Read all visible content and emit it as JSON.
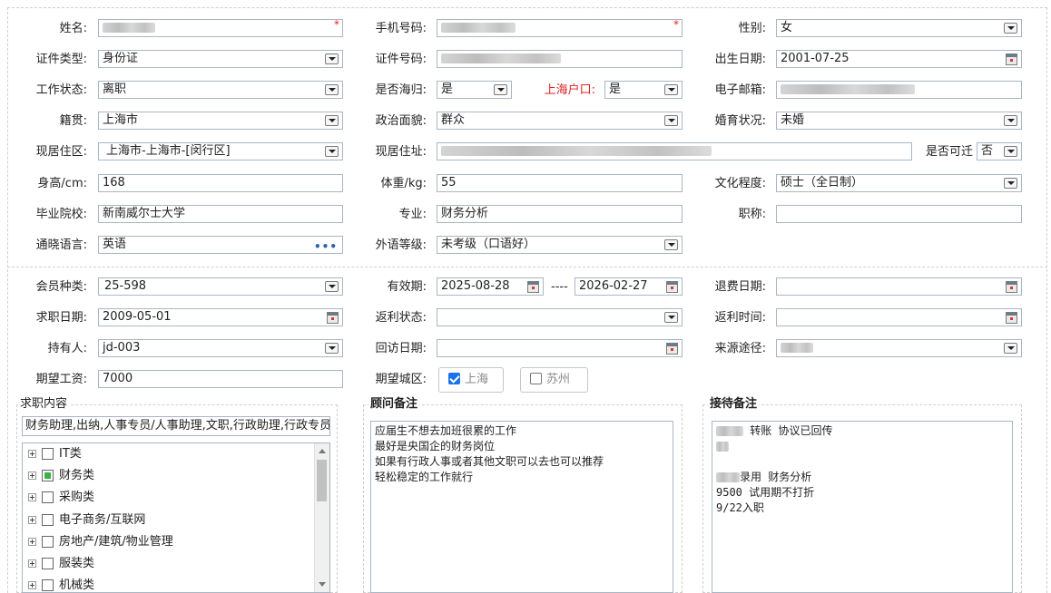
{
  "profile": {
    "name": {
      "label": "姓名:",
      "required_mark": "*"
    },
    "mobile": {
      "label": "手机号码:",
      "required_mark": "*"
    },
    "gender": {
      "label": "性别:",
      "value": "女"
    },
    "id_type": {
      "label": "证件类型:",
      "value": "身份证"
    },
    "id_number": {
      "label": "证件号码:"
    },
    "birth_date": {
      "label": "出生日期:",
      "value": "2001-07-25"
    },
    "work_status": {
      "label": "工作状态:",
      "value": "离职"
    },
    "returnee": {
      "label": "是否海归:",
      "value": "是"
    },
    "shanghai_hukou": {
      "label": "上海户口:",
      "value": "是"
    },
    "email": {
      "label": "电子邮箱:"
    },
    "native_place": {
      "label": "籍贯:",
      "value": "上海市"
    },
    "political": {
      "label": "政治面貌:",
      "value": "群众"
    },
    "marital": {
      "label": "婚育状况:",
      "value": "未婚"
    },
    "residence_area": {
      "label": "现居住区:",
      "value": "上海市-上海市-[闵行区]"
    },
    "address": {
      "label": "现居住址:"
    },
    "relocate": {
      "label": "是否可迁",
      "value": "否"
    },
    "height": {
      "label": "身高/cm:",
      "value": "168"
    },
    "weight": {
      "label": "体重/kg:",
      "value": "55"
    },
    "education": {
      "label": "文化程度:",
      "value": "硕士（全日制）"
    },
    "school": {
      "label": "毕业院校:",
      "value": "新南威尔士大学"
    },
    "major": {
      "label": "专业:",
      "value": "财务分析"
    },
    "title": {
      "label": "职称:",
      "value": ""
    },
    "languages": {
      "label": "通晓语言:",
      "value": "英语"
    },
    "foreign_level": {
      "label": "外语等级:",
      "value": "未考级（口语好）"
    }
  },
  "membership": {
    "member_type": {
      "label": "会员种类:",
      "value": "25-598"
    },
    "valid_period": {
      "label": "有效期:",
      "start": "2025-08-28",
      "sep": "----",
      "end": "2026-02-27"
    },
    "refund_date": {
      "label": "退费日期:",
      "value": ""
    },
    "job_seek_date": {
      "label": "求职日期:",
      "value": "2009-05-01"
    },
    "rebate_status": {
      "label": "返利状态:",
      "value": ""
    },
    "rebate_time": {
      "label": "返利时间:",
      "value": ""
    },
    "holder": {
      "label": "持有人:",
      "value": "jd-003"
    },
    "revisit_date": {
      "label": "回访日期:",
      "value": ""
    },
    "source": {
      "label": "来源途径:"
    },
    "expected_salary": {
      "label": "期望工资:",
      "value": "7000"
    },
    "expected_city": {
      "label": "期望城区:",
      "options": [
        {
          "label": "上海",
          "checked": true
        },
        {
          "label": "苏州",
          "checked": false
        }
      ]
    }
  },
  "job_content": {
    "title": "求职内容",
    "summary": "财务助理,出纳,人事专员/人事助理,文职,行政助理,行政专员",
    "tree": [
      {
        "label": "IT类",
        "checked": false
      },
      {
        "label": "财务类",
        "checked": true
      },
      {
        "label": "采购类",
        "checked": false
      },
      {
        "label": "电子商务/互联网",
        "checked": false
      },
      {
        "label": "房地产/建筑/物业管理",
        "checked": false
      },
      {
        "label": "服装类",
        "checked": false
      },
      {
        "label": "机械类",
        "checked": false
      }
    ]
  },
  "consultant_notes": {
    "title": "顾问备注",
    "lines": [
      "应届生不想去加班很累的工作",
      "最好是央国企的财务岗位",
      "如果有行政人事或者其他文职可以去也可以推荐",
      "轻松稳定的工作就行"
    ]
  },
  "reception_notes": {
    "title": "接待备注",
    "line1": " 转账 协议已回传",
    "line2": "录用 财务分析",
    "line3": "9500 试用期不打折",
    "line4": "9/22入职"
  }
}
